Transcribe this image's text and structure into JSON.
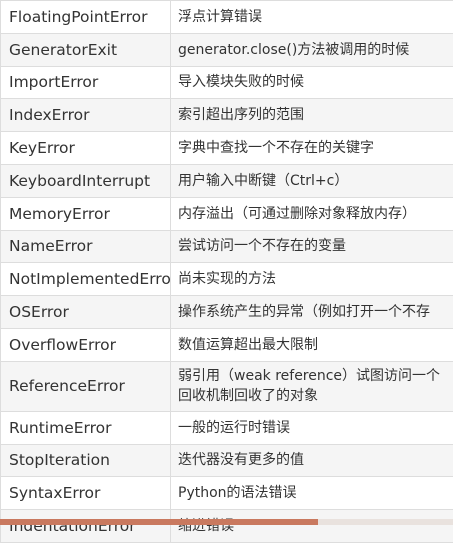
{
  "rows": [
    {
      "name": "FloatingPointError",
      "desc": "浮点计算错误"
    },
    {
      "name": "GeneratorExit",
      "desc": "generator.close()方法被调用的时候"
    },
    {
      "name": "ImportError",
      "desc": "导入模块失败的时候"
    },
    {
      "name": "IndexError",
      "desc": "索引超出序列的范围"
    },
    {
      "name": "KeyError",
      "desc": "字典中查找一个不存在的关键字"
    },
    {
      "name": "KeyboardInterrupt",
      "desc": "用户输入中断键（Ctrl+c）"
    },
    {
      "name": "MemoryError",
      "desc": "内存溢出（可通过删除对象释放内存）"
    },
    {
      "name": "NameError",
      "desc": "尝试访问一个不存在的变量"
    },
    {
      "name": "NotImplementedError",
      "desc": "尚未实现的方法"
    },
    {
      "name": "OSError",
      "desc": "操作系统产生的异常（例如打开一个不存"
    },
    {
      "name": "OverflowError",
      "desc": "数值运算超出最大限制"
    },
    {
      "name": "ReferenceError",
      "desc_line1": "弱引用（weak reference）试图访问一个",
      "desc_line2": "回收机制回收了的对象"
    },
    {
      "name": "RuntimeError",
      "desc": "一般的运行时错误"
    },
    {
      "name": "StopIteration",
      "desc": "迭代器没有更多的值"
    },
    {
      "name": "SyntaxError",
      "desc": "Python的语法错误"
    },
    {
      "name": "IndentationError",
      "desc": "缩进错误"
    }
  ]
}
